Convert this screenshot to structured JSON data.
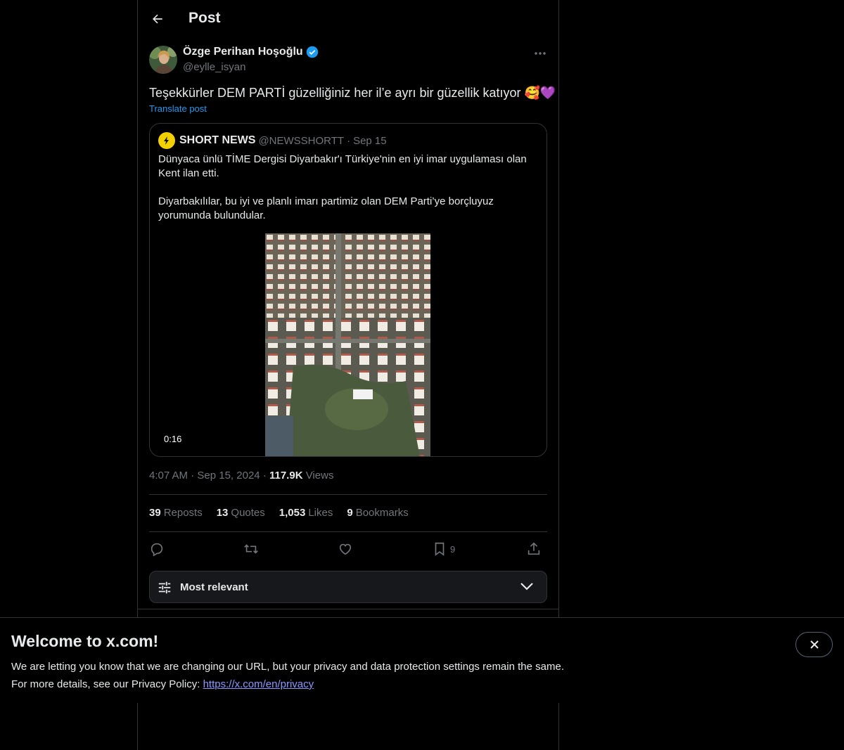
{
  "header": {
    "title": "Post"
  },
  "post": {
    "author_name": "Özge Perihan Hoşoğlu",
    "author_handle": "@eylle_isyan",
    "text": "Teşekkürler DEM PARTİ güzelliğiniz her il’e ayrı bir güzellik katıyor 🥰💜",
    "translate": "Translate post",
    "time": "4:07 AM",
    "date": "Sep 15, 2024",
    "views_count": "117.9K",
    "views_label": "Views",
    "dot": "·"
  },
  "quote": {
    "name": "SHORT NEWS",
    "handle": "@NEWSSHORTT",
    "sep": "·",
    "date": "Sep 15",
    "text_line1": "Dünyaca ünlü TİME Dergisi Diyarbakır'ı Türkiye'nin en iyi imar uygulaması olan Kent ilan etti.",
    "text_line2": "Diyarbakılılar, bu iyi ve planlı imarı partimiz olan DEM Parti’ye borçluyuz yorumunda bulundular.",
    "video_duration": "0:16"
  },
  "stats": [
    {
      "num": "39",
      "label": "Reposts"
    },
    {
      "num": "13",
      "label": "Quotes"
    },
    {
      "num": "1,053",
      "label": "Likes"
    },
    {
      "num": "9",
      "label": "Bookmarks"
    }
  ],
  "actions": {
    "bookmark_count": "9"
  },
  "sort": {
    "label": "Most relevant"
  },
  "banner": {
    "title": "Welcome to x.com!",
    "line1": "We are letting you know that we are changing our URL, but your privacy and data protection settings remain the same.",
    "line2_prefix": "For more details, see our Privacy Policy: ",
    "link": "https://x.com/en/privacy"
  },
  "colors": {
    "accent": "#1d9bf0",
    "link": "#8b98ff",
    "border": "#2f3336",
    "muted": "#71767b",
    "logo_yellow": "#f3d000"
  },
  "icons": [
    "back-arrow-icon",
    "verified-badge-icon",
    "more-icon",
    "reply-icon",
    "repost-icon",
    "like-icon",
    "bookmark-icon",
    "share-icon",
    "sliders-icon",
    "chevron-down-icon",
    "close-icon"
  ]
}
